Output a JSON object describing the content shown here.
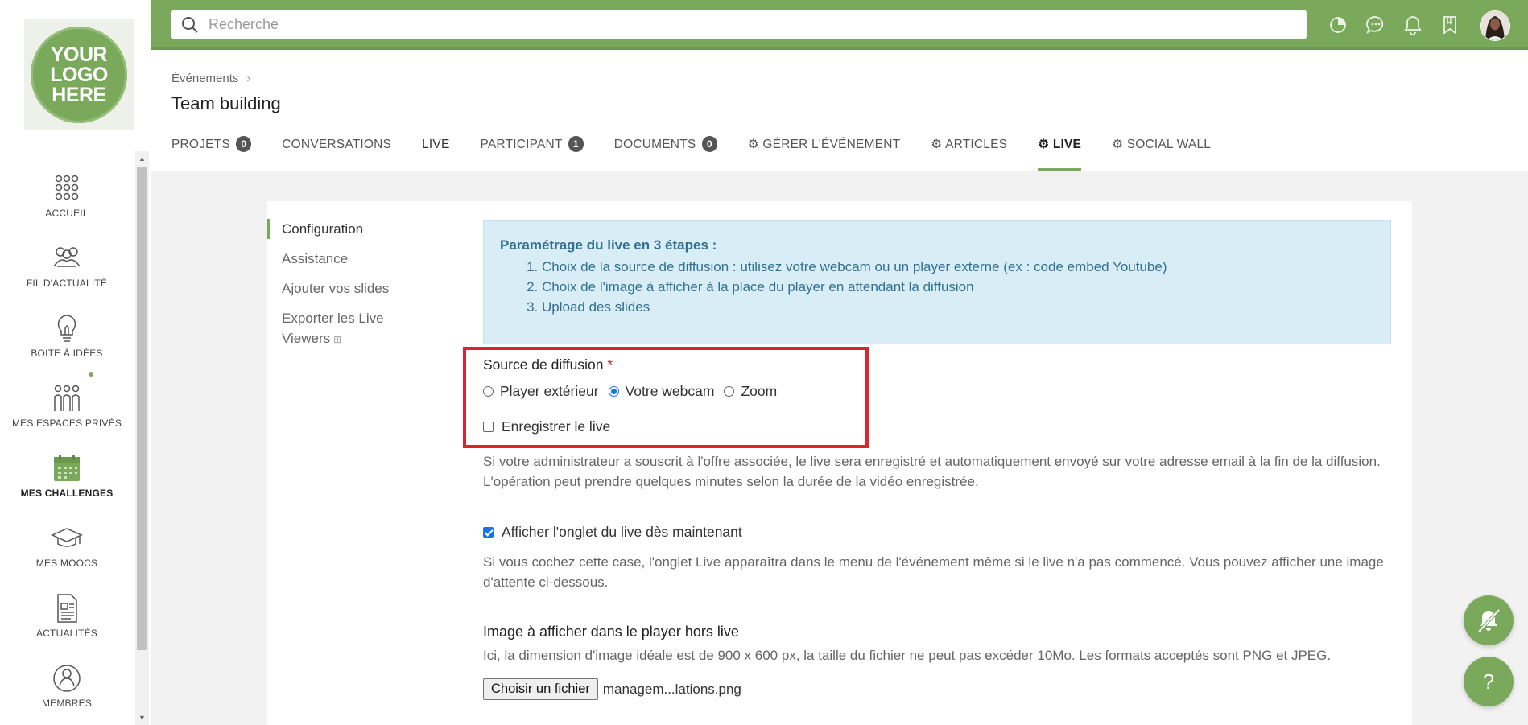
{
  "logo": {
    "lines": [
      "YOUR",
      "LOGO",
      "HERE"
    ]
  },
  "sidebar": {
    "items": [
      {
        "label": "ACCUEIL",
        "icon": "grid-icon"
      },
      {
        "label": "FIL D'ACTUALITÉ",
        "icon": "people-group-icon"
      },
      {
        "label": "BOITE À IDÉES",
        "icon": "lightbulb-icon"
      },
      {
        "label": "MES ESPACES PRIVÉS",
        "icon": "team-icon"
      },
      {
        "label": "MES CHALLENGES",
        "icon": "calendar-icon"
      },
      {
        "label": "MES MOOCS",
        "icon": "graduation-cap-icon"
      },
      {
        "label": "ACTUALITÉS",
        "icon": "news-icon"
      },
      {
        "label": "MEMBRES",
        "icon": "user-icon"
      }
    ],
    "active_index": 4
  },
  "topbar": {
    "search_placeholder": "Recherche",
    "icons": [
      "activity-icon",
      "chat-icon",
      "bell-icon",
      "bookmark-icon",
      "avatar"
    ]
  },
  "header": {
    "breadcrumb": "Événements",
    "title": "Team building"
  },
  "tabs": [
    {
      "label": "PROJETS",
      "badge": "0"
    },
    {
      "label": "CONVERSATIONS"
    },
    {
      "label": "LIVE"
    },
    {
      "label": "PARTICIPANT",
      "badge": "1"
    },
    {
      "label": "DOCUMENTS",
      "badge": "0"
    },
    {
      "label": "GÉRER L'ÉVÉNEMENT",
      "gear": true
    },
    {
      "label": "ARTICLES",
      "gear": true
    },
    {
      "label": "LIVE",
      "gear": true,
      "active": true
    },
    {
      "label": "SOCIAL WALL",
      "gear": true
    }
  ],
  "left_menu": {
    "items": [
      "Configuration",
      "Assistance",
      "Ajouter vos slides",
      "Exporter les Live Viewers"
    ],
    "active": "Configuration"
  },
  "info": {
    "title": "Paramétrage du live en 3 étapes :",
    "steps": [
      "Choix de la source de diffusion : utilisez votre webcam ou un player externe (ex : code embed Youtube)",
      "Choix de l'image à afficher à la place du player en attendant la diffusion",
      "Upload des slides"
    ]
  },
  "form": {
    "source_label": "Source de diffusion",
    "required_mark": "*",
    "source_options": [
      "Player extérieur",
      "Votre webcam",
      "Zoom"
    ],
    "source_selected": "Votre webcam",
    "record_label": "Enregistrer le live",
    "record_checked": false,
    "record_help": "Si votre administrateur a souscrit à l'offre associée, le live sera enregistré et automatiquement envoyé sur votre adresse email à la fin de la diffusion. L'opération peut prendre quelques minutes selon la durée de la vidéo enregistrée.",
    "show_tab_label": "Afficher l'onglet du live dès maintenant",
    "show_tab_checked": true,
    "show_tab_help": "Si vous cochez cette case, l'onglet Live apparaîtra dans le menu de l'événement même si le live n'a pas commencé. Vous pouvez afficher une image d'attente ci-dessous.",
    "image_label": "Image à afficher dans le player hors live",
    "image_help": "Ici, la dimension d'image idéale est de 900 x 600 px, la taille du fichier ne peut pas excéder 10Mo. Les formats acceptés sont PNG et JPEG.",
    "file_button": "Choisir un fichier",
    "file_name": "managem...lations.png"
  },
  "fabs": {
    "help_label": "?"
  },
  "colors": {
    "brand_green": "#7aa95c",
    "info_bg": "#d9edf7",
    "info_text": "#31708f",
    "highlight_red": "#d9252f"
  }
}
